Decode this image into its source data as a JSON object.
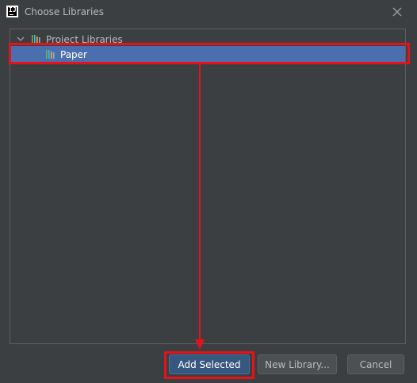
{
  "window": {
    "title": "Choose Libraries",
    "app_icon": "intellij-icon",
    "close_icon": "close-icon"
  },
  "tree": {
    "group": {
      "label": "Project Libraries",
      "expanded": true,
      "icon": "library-icon"
    },
    "items": [
      {
        "label": "Paper",
        "selected": true,
        "icon": "library-icon"
      }
    ]
  },
  "buttons": {
    "add_selected": "Add Selected",
    "new_library": "New Library...",
    "cancel": "Cancel"
  },
  "colors": {
    "background": "#3c3f41",
    "selection": "#4b6eaf",
    "primary_button": "#365880",
    "annotation": "#e8101a"
  }
}
